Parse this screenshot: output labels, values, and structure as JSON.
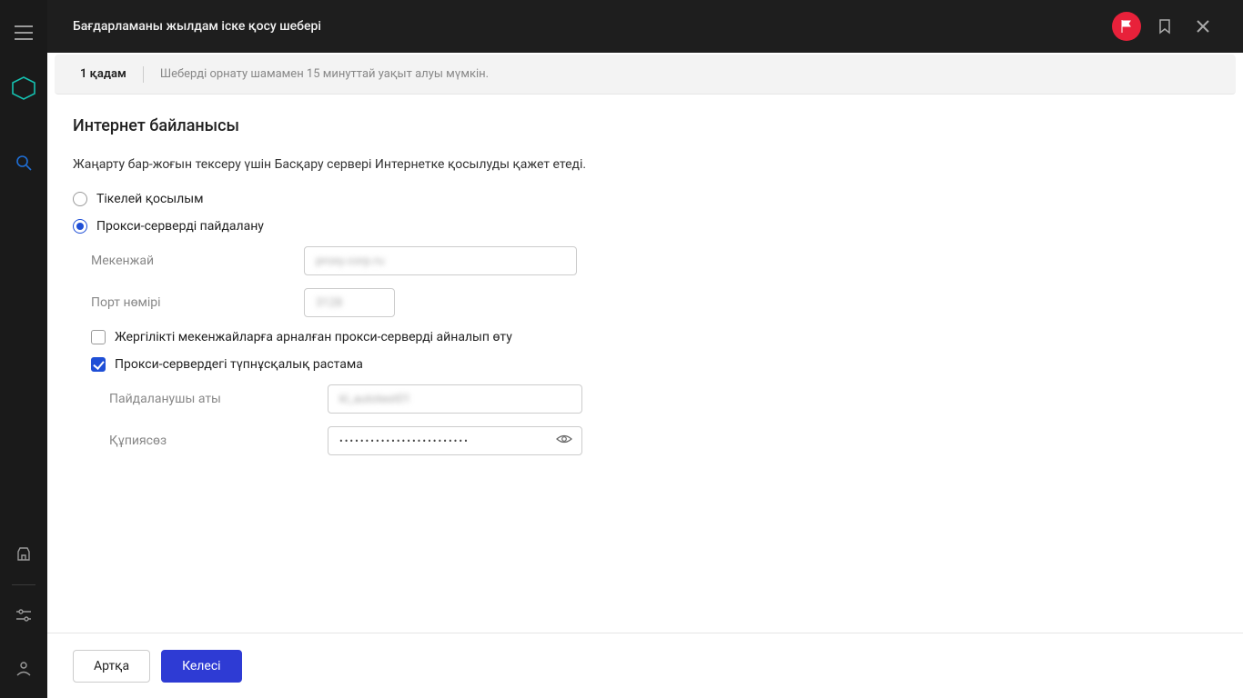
{
  "header": {
    "title": "Бағдарламаны жылдам іске қосу шебері"
  },
  "step": {
    "label": "1 қадам",
    "description": "Шеберді орнату шамамен 15 минуттай уақыт алуы мүмкін."
  },
  "section": {
    "heading": "Интернет байланысы",
    "intro": "Жаңарту бар-жоғын тексеру үшін Басқару сервері Интернетке қосылуды қажет етеді."
  },
  "radios": {
    "direct": "Тікелей қосылым",
    "proxy": "Прокси-серверді пайдалану"
  },
  "fields": {
    "address_label": "Мекенжай",
    "address_value": "proxy.corp.ru",
    "port_label": "Порт нөмірі",
    "port_value": "3128",
    "bypass_label": "Жергілікті мекенжайларға арналған прокси-серверді айналып өту",
    "auth_label": "Прокси-сервердегі түпнұсқалық растама",
    "username_label": "Пайдаланушы аты",
    "username_value": "kl_autotest01",
    "password_label": "Құпиясөз",
    "password_dots": "•••••••••••••••••••••••••"
  },
  "footer": {
    "back": "Артқа",
    "next": "Келесі"
  }
}
